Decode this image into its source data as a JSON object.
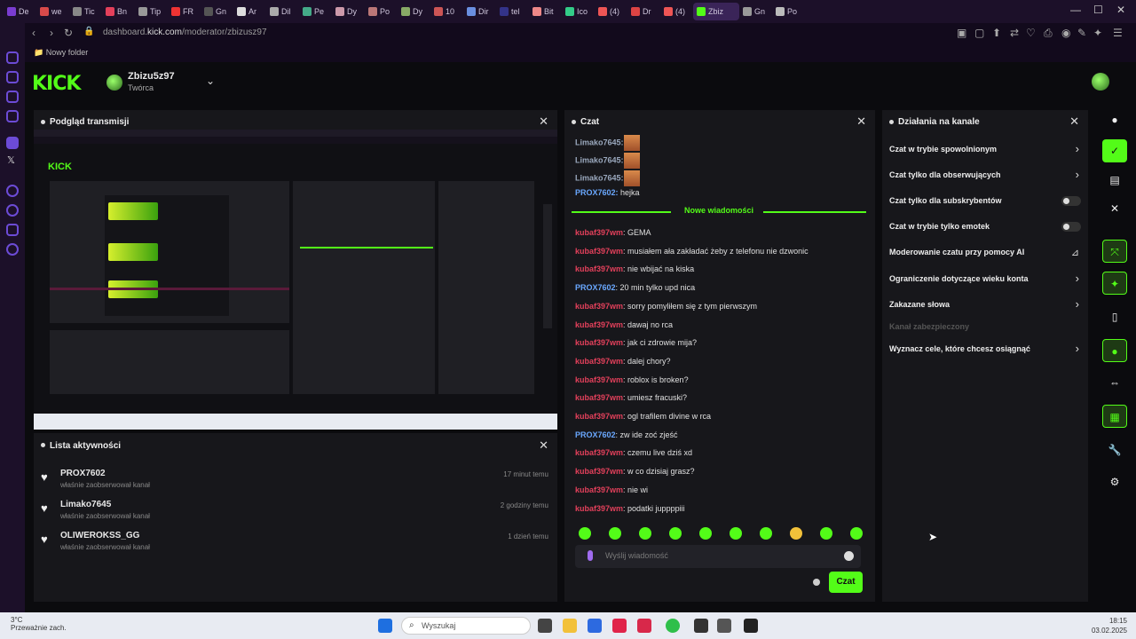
{
  "browser": {
    "tabs": [
      "De",
      "we",
      "Tic",
      "Bn",
      "Tip",
      "FR",
      "Gn",
      "Ar",
      "Dil",
      "Pe",
      "Dy",
      "Po",
      "Dy",
      "10",
      "Dir",
      "tel",
      "Bit",
      "Ico",
      "(4)",
      "Dr",
      "(4)",
      "Gn",
      "Po"
    ],
    "active_tab": "Zbiz",
    "url_prefix": "dashboard.",
    "url_domain": "kick.com",
    "url_path": "/moderator/zbizusz97",
    "bookmark": "Nowy folder"
  },
  "header": {
    "logo": "KICK",
    "channel_name": "Zbizu5z97",
    "channel_role": "Twórca"
  },
  "preview": {
    "title": "Podgląd transmisji"
  },
  "activity": {
    "title": "Lista aktywności",
    "items": [
      {
        "name": "PROX7602",
        "sub": "właśnie zaobserwował kanał",
        "time": "17 minut temu"
      },
      {
        "name": "Limako7645",
        "sub": "właśnie zaobserwował kanał",
        "time": "2 godziny temu"
      },
      {
        "name": "OLIWEROKSS_GG",
        "sub": "właśnie zaobserwował kanał",
        "time": "1 dzień temu"
      }
    ]
  },
  "chat": {
    "title": "Czat",
    "pre_messages": [
      {
        "user": "Limako7645:",
        "cls": "u-gray",
        "emote": true,
        "text": ""
      },
      {
        "user": "Limako7645:",
        "cls": "u-gray",
        "emote": true,
        "text": ""
      },
      {
        "user": "Limako7645:",
        "cls": "u-gray",
        "emote": true,
        "text": ""
      },
      {
        "user": "PROX7602:",
        "cls": "u-blue",
        "emote": false,
        "text": " hejka"
      }
    ],
    "new_messages_label": "Nowe wiadomości",
    "messages": [
      {
        "user": "kubaf397wm",
        "cls": "u-red",
        "text": ": GEMA"
      },
      {
        "user": "kubaf397wm",
        "cls": "u-red",
        "text": ": musiałem ała zakładać żeby z telefonu nie dzwonic"
      },
      {
        "user": "kubaf397wm",
        "cls": "u-red",
        "text": ": nie wbijać na kiska"
      },
      {
        "user": "PROX7602",
        "cls": "u-blue",
        "text": ": 20 min tylko upd nica"
      },
      {
        "user": "kubaf397wm",
        "cls": "u-red",
        "text": ": sorry pomyliłem się z tym pierwszym"
      },
      {
        "user": "kubaf397wm",
        "cls": "u-red",
        "text": ": dawaj no rca"
      },
      {
        "user": "kubaf397wm",
        "cls": "u-red",
        "text": ": jak ci zdrowie mija?"
      },
      {
        "user": "kubaf397wm",
        "cls": "u-red",
        "text": ": dalej chory?"
      },
      {
        "user": "kubaf397wm",
        "cls": "u-red",
        "text": ": roblox is broken?"
      },
      {
        "user": "kubaf397wm",
        "cls": "u-red",
        "text": ": umiesz fracuski?"
      },
      {
        "user": "kubaf397wm",
        "cls": "u-red",
        "text": ": ogl trafilem divine w rca"
      },
      {
        "user": "PROX7602",
        "cls": "u-blue",
        "text": ": zw ide zoć zjeść"
      },
      {
        "user": "kubaf397wm",
        "cls": "u-red",
        "text": ": czemu live dziś xd"
      },
      {
        "user": "kubaf397wm",
        "cls": "u-red",
        "text": ": w co dzisiaj grasz?"
      },
      {
        "user": "kubaf397wm",
        "cls": "u-red",
        "text": ": nie wi"
      },
      {
        "user": "kubaf397wm",
        "cls": "u-red",
        "text": ": podatki juppppiii"
      }
    ],
    "input_placeholder": "Wyślij wiadomość",
    "send_label": "Czat"
  },
  "channel_actions": {
    "title": "Działania na kanale",
    "items": [
      {
        "label": "Czat w trybie spowolnionym",
        "control": "chevron"
      },
      {
        "label": "Czat tylko dla obserwujących",
        "control": "chevron"
      },
      {
        "label": "Czat tylko dla subskrybentów",
        "control": "toggle"
      },
      {
        "label": "Czat w trybie tylko emotek",
        "control": "toggle"
      },
      {
        "label": "Moderowanie czatu przy pomocy AI",
        "control": "chart"
      },
      {
        "label": "Ograniczenie dotyczące wieku konta",
        "control": "chevron"
      },
      {
        "label": "Zakazane słowa",
        "control": "chevron"
      },
      {
        "label": "Kanał zabezpieczony",
        "control": "muted"
      },
      {
        "label": "Wyznacz cele, które chcesz osiągnąć",
        "control": "chevron"
      }
    ]
  },
  "taskbar": {
    "weather": "3°C",
    "weather_sub": "Przeważnie zach.",
    "search_placeholder": "Wyszukaj",
    "time": "18:15",
    "date": "03.02.2025"
  },
  "colors": {
    "accent": "#53fc18",
    "brand_purple": "#6c4bd6"
  }
}
